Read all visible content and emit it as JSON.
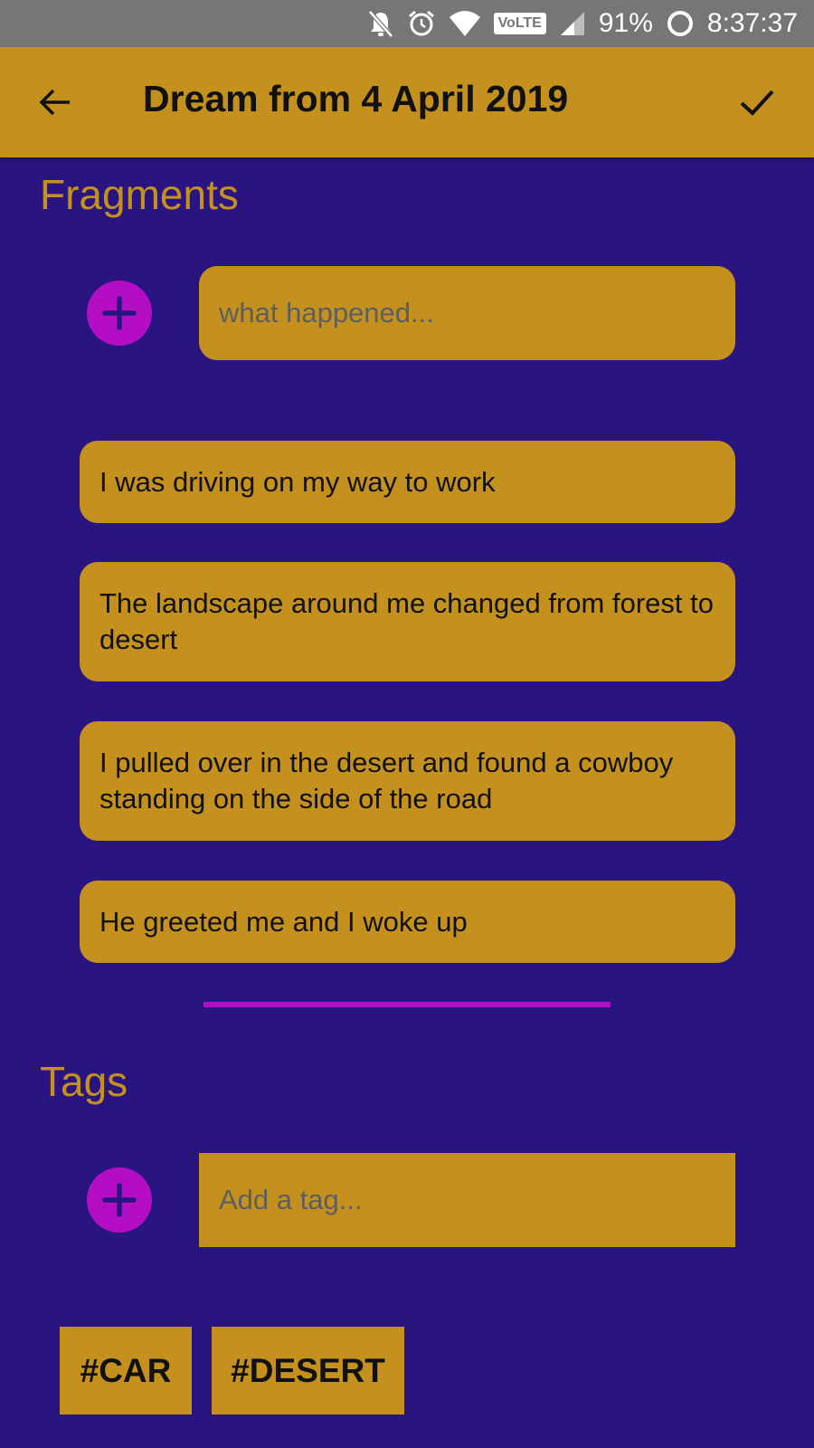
{
  "status_bar": {
    "battery": "91%",
    "time": "8:37:37",
    "network_badge": "VoLTE",
    "icons": [
      "notifications-off-icon",
      "alarm-icon",
      "wifi-icon",
      "volte-icon",
      "signal-icon",
      "battery-ring-icon"
    ]
  },
  "app_bar": {
    "title": "Dream from 4 April 2019",
    "back_icon": "arrow-back-icon",
    "confirm_icon": "check-icon"
  },
  "fragments": {
    "heading": "Fragments",
    "input_placeholder": "what happened...",
    "add_icon": "plus-icon",
    "items": [
      {
        "text": "I was driving on my way to work"
      },
      {
        "text": "The landscape around me changed from forest to desert"
      },
      {
        "text": "I pulled over in the desert and found a cowboy standing on the side of the road"
      },
      {
        "text": "He greeted me and I woke up"
      }
    ]
  },
  "tags": {
    "heading": "Tags",
    "input_placeholder": "Add a tag...",
    "add_icon": "plus-icon",
    "items": [
      {
        "label": "#CAR"
      },
      {
        "label": "#DESERT"
      }
    ]
  },
  "colors": {
    "background": "#2a1580",
    "accent_gold": "#c4911e",
    "accent_magenta": "#b40ec4",
    "status_bar": "#767676"
  }
}
